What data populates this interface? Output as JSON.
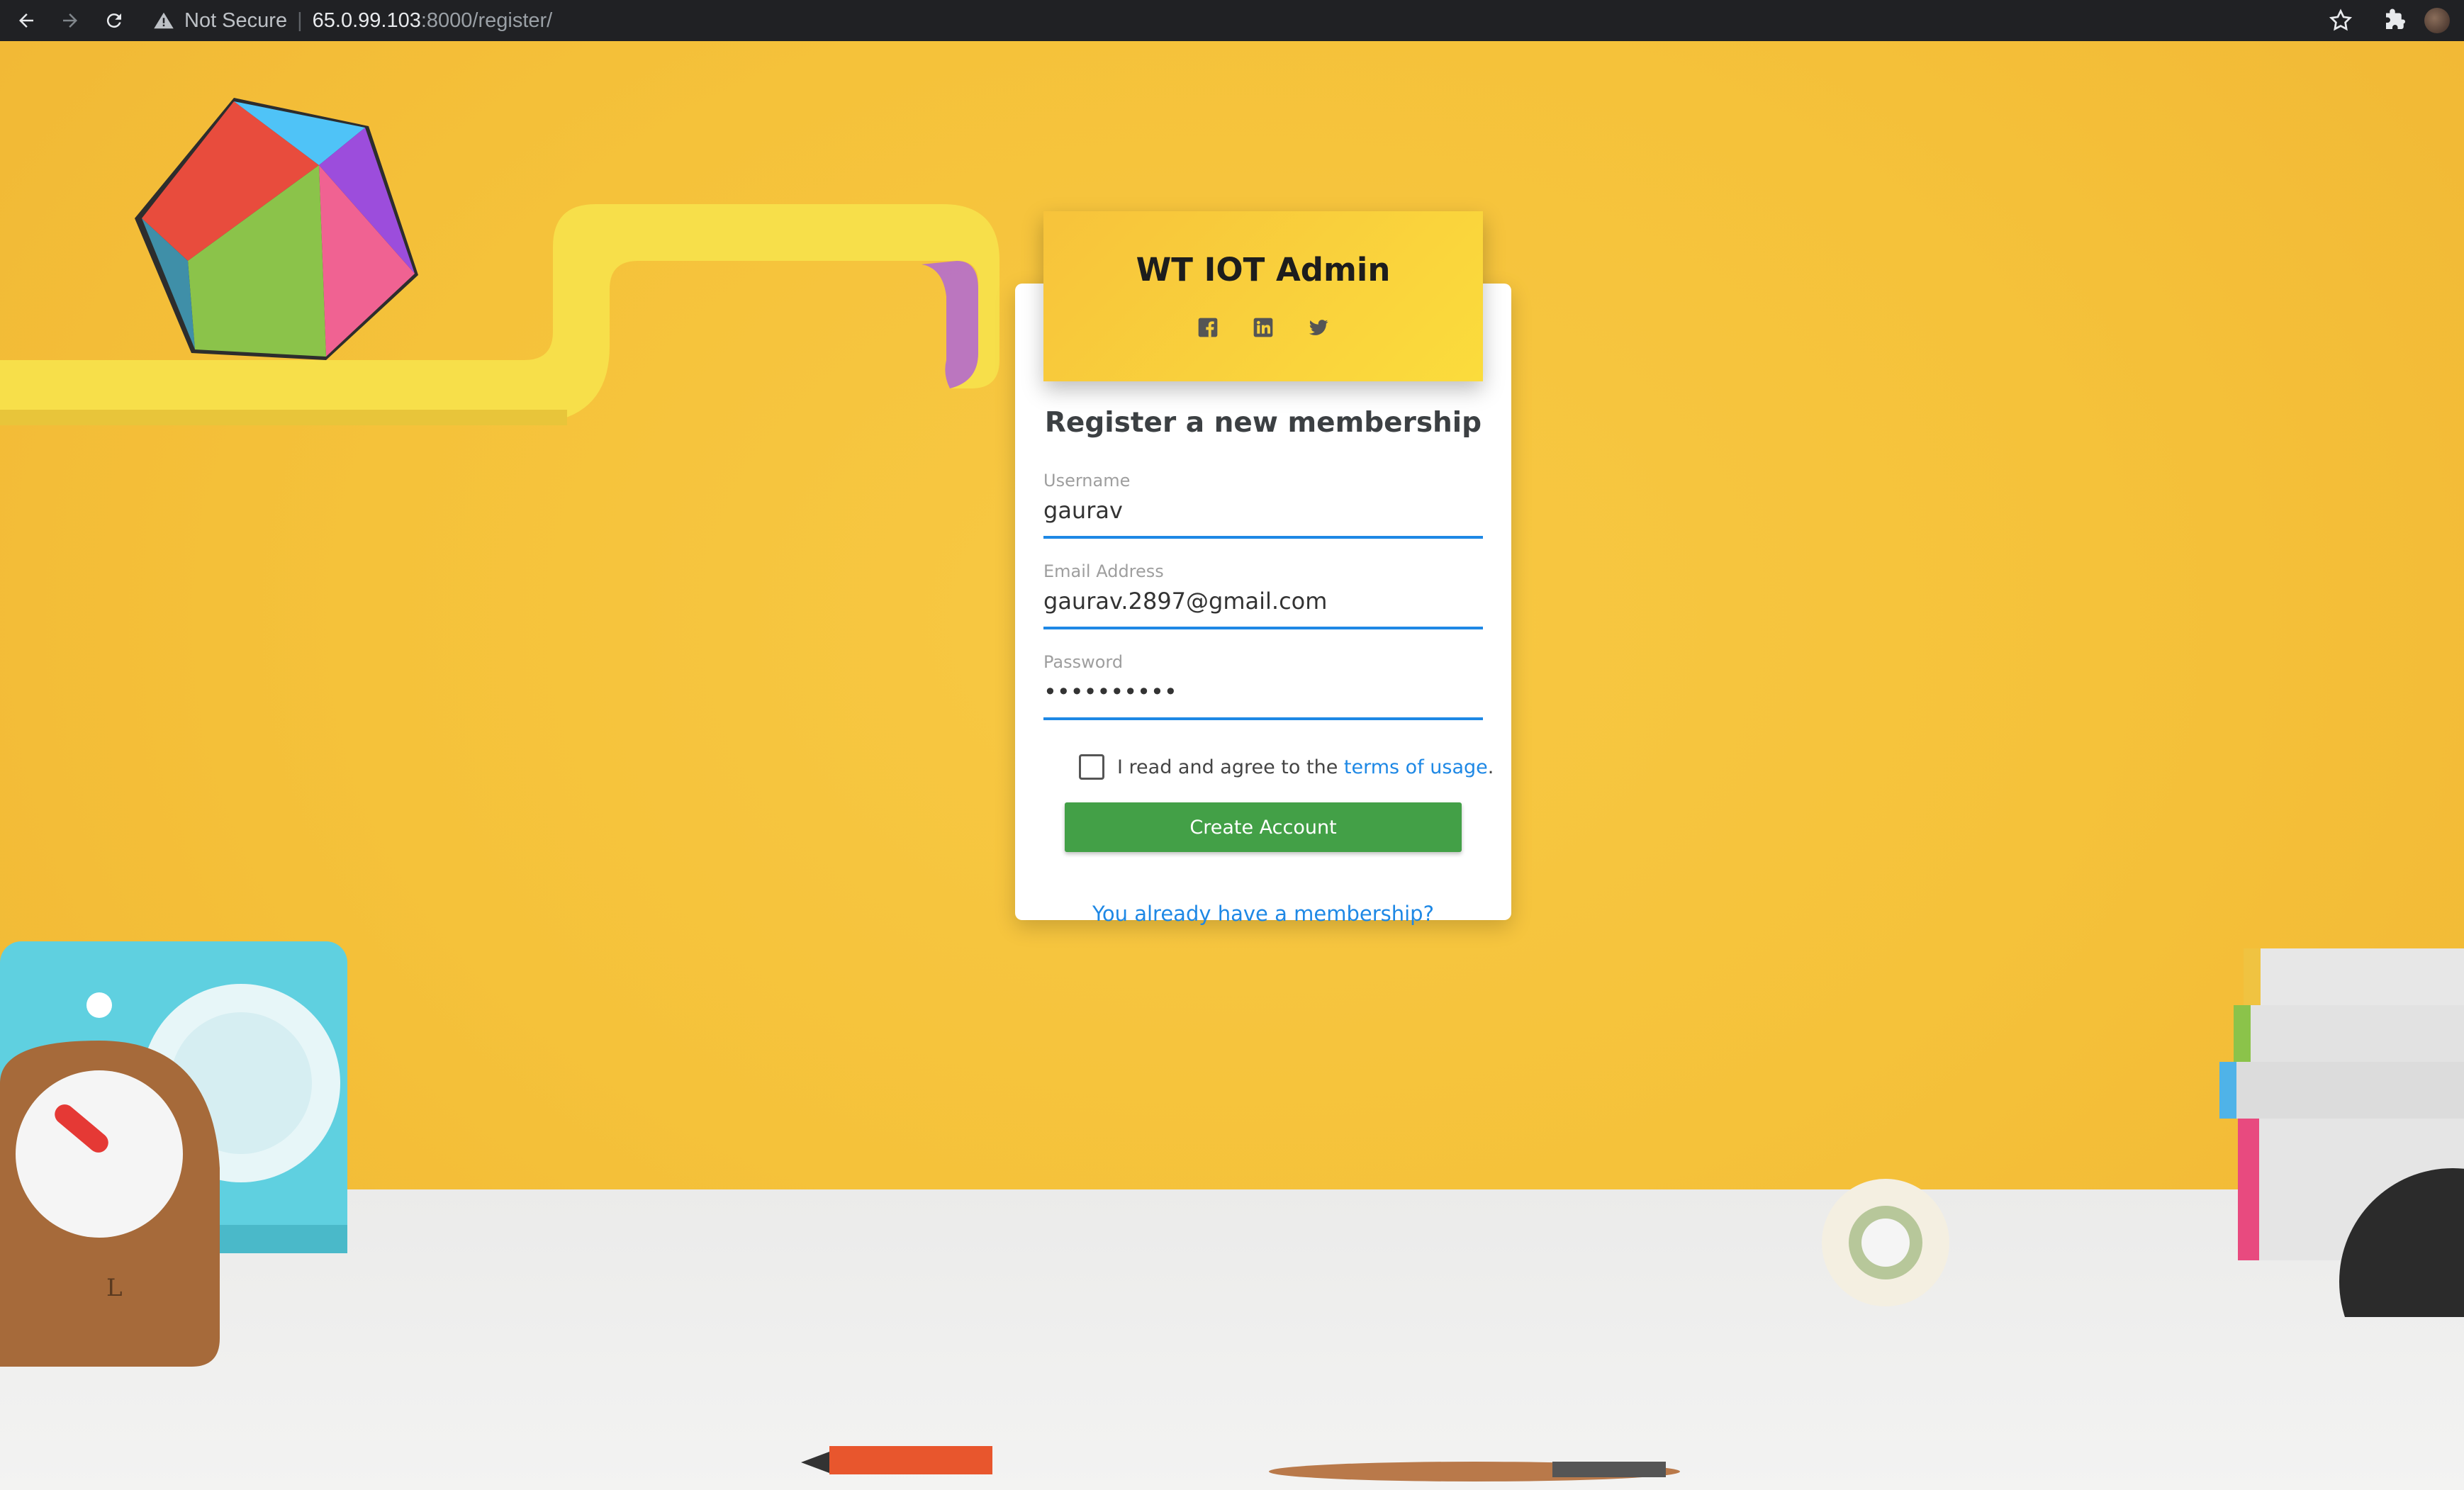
{
  "browser": {
    "security_label": "Not Secure",
    "url_host": "65.0.99.103",
    "url_path": ":8000/register/"
  },
  "header": {
    "title": "WT IOT Admin",
    "social_icons": [
      "facebook-icon",
      "linkedin-icon",
      "twitter-icon"
    ]
  },
  "form": {
    "subtitle": "Register a new membership",
    "username_label": "Username",
    "username_value": "gaurav",
    "email_label": "Email Address",
    "email_value": "gaurav.2897@gmail.com",
    "password_label": "Password",
    "password_value": "••••••••••",
    "agree_prefix": "I read and agree to the ",
    "terms_link": "terms of usage",
    "agree_suffix": ".",
    "create_button": "Create Account",
    "membership_link": "You already have a membership?"
  },
  "colors": {
    "accent": "#1e88e5",
    "button": "#43a047",
    "background": "#f5c43c"
  }
}
